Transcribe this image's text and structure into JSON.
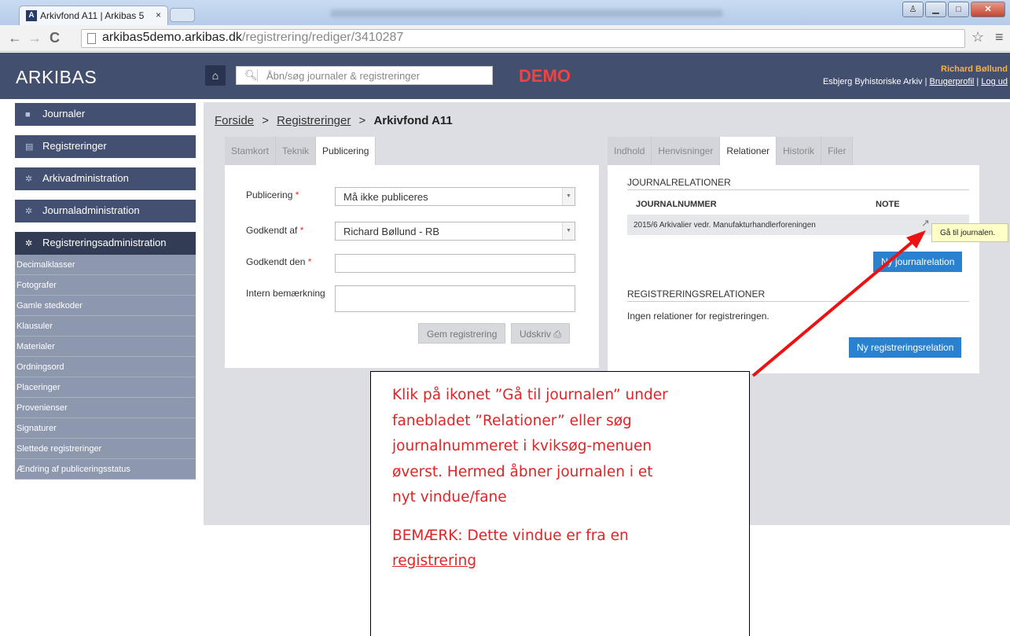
{
  "browser": {
    "tab_title": "Arkivfond A11 | Arkibas 5",
    "tab_close": "×",
    "favicon_letter": "A",
    "url_host": "arkibas5demo.arkibas.dk",
    "url_path": "/registrering/rediger/3410287",
    "back": "←",
    "forward": "→",
    "reload": "C",
    "star": "☆",
    "menu": "≡",
    "win_min": "▁",
    "win_max": "□",
    "win_close": "✕"
  },
  "header": {
    "logo": "ARKIBAS",
    "home_icon": "⌂",
    "search_placeholder": "Åbn/søg journaler & registreringer",
    "search_icon": "🔍︎",
    "demo_label": "DEMO",
    "user_name": "Richard Bøllund",
    "org": "Esbjerg Byhistoriske Arkiv",
    "link_profile": "Brugerprofil",
    "link_logout": "Log ud",
    "sep": "|"
  },
  "sidebar": {
    "main_items": [
      {
        "label": "Journaler",
        "icon": "folder-icon"
      },
      {
        "label": "Registreringer",
        "icon": "archive-icon"
      },
      {
        "label": "Arkivadministration",
        "icon": "gear-icon"
      },
      {
        "label": "Journaladministration",
        "icon": "gear-icon"
      },
      {
        "label": "Registreringsadministration",
        "icon": "gear-icon"
      }
    ],
    "sub_items": [
      "Decimalklasser",
      "Fotografer",
      "Gamle stedkoder",
      "Klausuler",
      "Materialer",
      "Ordningsord",
      "Placeringer",
      "Provenienser",
      "Signaturer",
      "Slettede registreringer",
      "Ændring af publiceringsstatus"
    ]
  },
  "breadcrumb": {
    "home": "Forside",
    "section": "Registreringer",
    "current": "Arkivfond A11",
    "sep": ">"
  },
  "left_tabs": [
    "Stamkort",
    "Teknik",
    "Publicering"
  ],
  "form": {
    "publicering_label": "Publicering",
    "publicering_value": "Må ikke publiceres",
    "godkendt_af_label": "Godkendt af",
    "godkendt_af_value": "Richard Bøllund - RB",
    "godkendt_den_label": "Godkendt den",
    "godkendt_den_value": "",
    "intern_label": "Intern bemærkning",
    "intern_value": "",
    "required_marker": "*",
    "save_button": "Gem registrering",
    "print_button": "Udskriv",
    "print_icon": "⎙"
  },
  "right_tabs": [
    "Indhold",
    "Henvisninger",
    "Relationer",
    "Historik",
    "Filer"
  ],
  "relations": {
    "journal_title": "JOURNALRELATIONER",
    "col_number": "JOURNALNUMMER",
    "col_note": "NOTE",
    "rows": [
      {
        "number": "2015/6 Arkivalier vedr. Manufakturhandlerforeningen",
        "note": ""
      }
    ],
    "ext_icon": "↗",
    "tooltip": "Gå til journalen.",
    "new_journal_button": "Ny journalrelation",
    "reg_title": "REGISTRERINGSRELATIONER",
    "no_relations": "Ingen relationer for registreringen.",
    "new_reg_button": "Ny registreringsrelation"
  },
  "callout": {
    "line1": "Klik på ikonet ”Gå til journalen” under",
    "line2": "fanebladet ”Relationer” eller søg",
    "line3": "journalnummeret i kviksøg-menuen",
    "line4": "øverst. Hermed åbner journalen i et",
    "line5": "nyt vindue/fane",
    "note_prefix": "BEMÆRK: Dette vindue er fra en",
    "note_link": "registrering"
  },
  "colors": {
    "header_bg": "#434f6e",
    "sidebar_item": "#435071",
    "accent_blue": "#2a81d0",
    "demo_red": "#e44444",
    "callout_red": "#e12426",
    "arrow_red": "#ee1111"
  }
}
